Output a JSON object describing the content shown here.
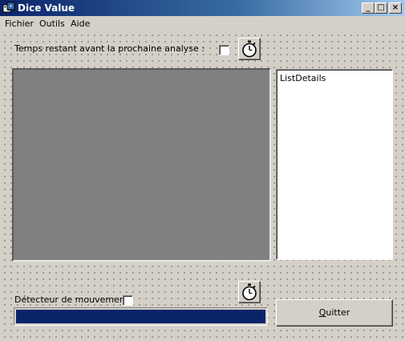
{
  "window": {
    "title": "Dice Value",
    "controls": {
      "minimize": "_",
      "maximize": "□",
      "close": "×"
    }
  },
  "menu": {
    "items": [
      "Fichier",
      "Outils",
      "Aide"
    ]
  },
  "analysis": {
    "label": "Temps restant avant la prochaine analyse :",
    "checked": false,
    "timer_icon": "stopwatch-icon"
  },
  "details_list": {
    "items": [
      "ListDetails"
    ]
  },
  "motion": {
    "label": "Détecteur de mouvements",
    "checked": false,
    "timer_icon": "stopwatch-icon",
    "progress_fraction": 1.0,
    "progress_color": "#0a246a"
  },
  "quit_button": {
    "mnemonic": "Q",
    "rest": "uitter"
  },
  "colors": {
    "title_bar": "#0a246a",
    "window_bg": "#d4d0c8",
    "video_bg": "#808080"
  }
}
